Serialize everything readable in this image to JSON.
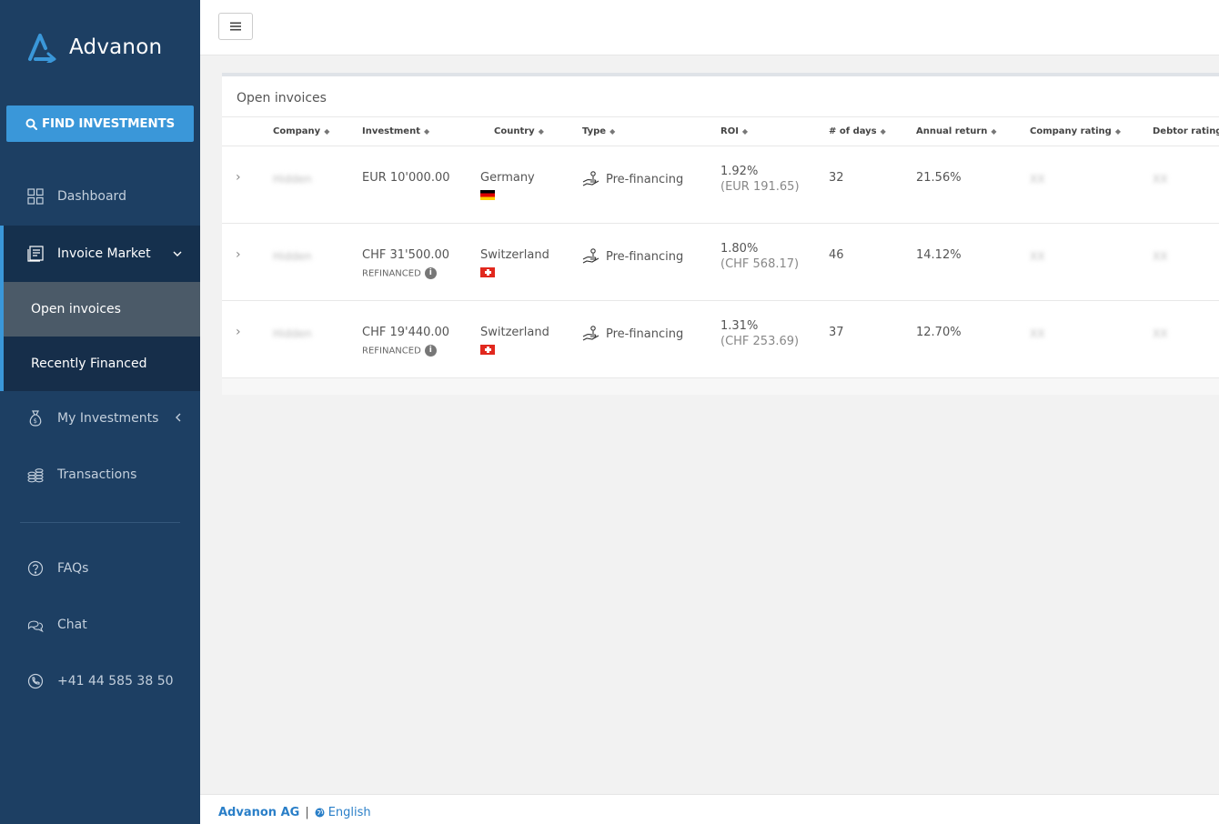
{
  "brand": {
    "name": "Advanon"
  },
  "sidebar": {
    "find_button": "FIND INVESTMENTS",
    "items": [
      {
        "label": "Dashboard",
        "icon": "dashboard-grid-icon"
      },
      {
        "label": "Invoice Market",
        "icon": "invoice-icon",
        "active": true
      },
      {
        "label": "My Investments",
        "icon": "money-bag-icon"
      },
      {
        "label": "Transactions",
        "icon": "coins-icon"
      },
      {
        "label": "FAQs",
        "icon": "question-circle-icon"
      },
      {
        "label": "Chat",
        "icon": "chat-bubbles-icon"
      },
      {
        "label": "+41 44 585 38 50",
        "icon": "phone-icon"
      }
    ],
    "subitems": [
      {
        "label": "Open invoices",
        "selected": true
      },
      {
        "label": "Recently Financed"
      }
    ]
  },
  "panel": {
    "title": "Open invoices",
    "columns": [
      "Company",
      "Investment",
      "Country",
      "Type",
      "ROI",
      "# of days",
      "Annual return",
      "Company rating",
      "Debtor rating"
    ],
    "rows": [
      {
        "company": "Hidden",
        "investment": "EUR 10'000.00",
        "refinanced": "",
        "country": "Germany",
        "flag": "de",
        "type": "Pre-financing",
        "roi": "1.92%",
        "roi_amount": "(EUR 191.65)",
        "days": "32",
        "annual_return": "21.56%",
        "company_rating": "XX",
        "debtor_rating": "XX"
      },
      {
        "company": "Hidden",
        "investment": "CHF 31'500.00",
        "refinanced": "REFINANCED",
        "country": "Switzerland",
        "flag": "ch",
        "type": "Pre-financing",
        "roi": "1.80%",
        "roi_amount": "(CHF 568.17)",
        "days": "46",
        "annual_return": "14.12%",
        "company_rating": "XX",
        "debtor_rating": "XX"
      },
      {
        "company": "Hidden",
        "investment": "CHF 19'440.00",
        "refinanced": "REFINANCED",
        "country": "Switzerland",
        "flag": "ch",
        "type": "Pre-financing",
        "roi": "1.31%",
        "roi_amount": "(CHF 253.69)",
        "days": "37",
        "annual_return": "12.70%",
        "company_rating": "XX",
        "debtor_rating": "XX"
      }
    ]
  },
  "footer": {
    "company": "Advanon AG",
    "separator": "|",
    "language": "English"
  },
  "colors": {
    "sidebar_bg": "#1d3f63",
    "accent": "#3a97d9",
    "active_bg": "#15304d"
  }
}
